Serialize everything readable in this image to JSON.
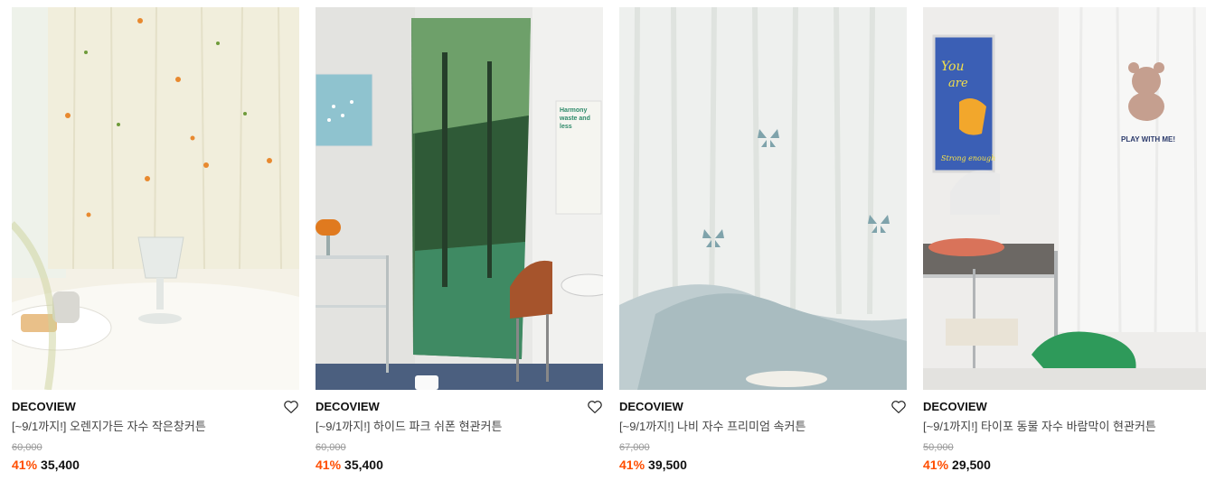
{
  "products": [
    {
      "brand": "DECOVIEW",
      "name": "[~9/1까지!] 오렌지가든 자수 작은창커튼",
      "original_price": "60,000",
      "discount": "41%",
      "price": "35,400",
      "image": "orange-garden-curtain",
      "colors": {
        "bg": "#f3f0e2",
        "accent": "#e8892f"
      }
    },
    {
      "brand": "DECOVIEW",
      "name": "[~9/1까지!] 하이드 파크 쉬폰 현관커튼",
      "original_price": "60,000",
      "discount": "41%",
      "price": "35,400",
      "image": "forest-print-curtain",
      "colors": {
        "bg": "#e9e9e7",
        "accent": "#3c7a4e"
      }
    },
    {
      "brand": "DECOVIEW",
      "name": "[~9/1까지!] 나비 자수 프리미엄 속커튼",
      "original_price": "67,000",
      "discount": "41%",
      "price": "39,500",
      "image": "butterfly-sheer-curtain",
      "colors": {
        "bg": "#eef0ee",
        "accent": "#7fa3ab"
      }
    },
    {
      "brand": "DECOVIEW",
      "name": "[~9/1까지!] 타이포 동물 자수 바람막이 현관커튼",
      "original_price": "50,000",
      "discount": "41%",
      "price": "29,500",
      "image": "typo-animal-curtain",
      "colors": {
        "bg": "#efeeec",
        "accent": "#2e9a5a"
      }
    }
  ],
  "poster_text": {
    "harmony": "Harmony waste and less",
    "you_are": "You are",
    "strong": "Strong enough",
    "play": "PLAY WITH ME!"
  }
}
